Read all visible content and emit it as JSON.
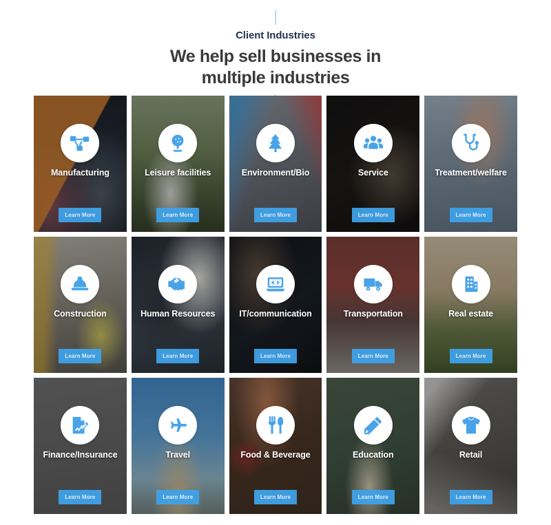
{
  "header": {
    "eyebrow": "Client Industries",
    "headline": "We help sell businesses in multiple industries",
    "headline_line1": "We help sell businesses in",
    "headline_line2": "multiple industries"
  },
  "theme": {
    "accent": "#3fa2e8",
    "icon_blue": "#49a3e8",
    "eyebrow_color": "#23344f",
    "headline_color": "#3a3a3c",
    "badge_bg": "#ffffff",
    "tick_color": "#b9d7f2",
    "page_bg": "#ffffff"
  },
  "cta_label": "Learn More",
  "cards": [
    {
      "label": "Manufacturing",
      "icon": "network-nodes-icon",
      "photo_class": "ph-manufacturing",
      "cta": "Learn More"
    },
    {
      "label": "Leisure facilities",
      "icon": "golf-ball-tee-icon",
      "photo_class": "ph-leisure",
      "cta": "Learn More"
    },
    {
      "label": "Environment/Bio",
      "icon": "pine-tree-icon",
      "photo_class": "ph-environment",
      "cta": "Learn More"
    },
    {
      "label": "Service",
      "icon": "people-group-icon",
      "photo_class": "ph-service",
      "cta": "Learn More"
    },
    {
      "label": "Treatment/welfare",
      "icon": "stethoscope-icon",
      "photo_class": "ph-treatment",
      "cta": "Learn More"
    },
    {
      "label": "Construction",
      "icon": "hard-hat-icon",
      "photo_class": "ph-construction",
      "cta": "Learn More"
    },
    {
      "label": "Human Resources",
      "icon": "handshake-icon",
      "photo_class": "ph-hr",
      "cta": "Learn More"
    },
    {
      "label": "IT/communication",
      "icon": "laptop-code-icon",
      "photo_class": "ph-it",
      "cta": "Learn More"
    },
    {
      "label": "Transportation",
      "icon": "truck-icon",
      "photo_class": "ph-transport",
      "cta": "Learn More"
    },
    {
      "label": "Real estate",
      "icon": "building-icon",
      "photo_class": "ph-realestate",
      "cta": "Learn More"
    },
    {
      "label": "Finance/Insurance",
      "icon": "document-pen-icon",
      "photo_class": "ph-finance",
      "cta": "Learn More"
    },
    {
      "label": "Travel",
      "icon": "airplane-icon",
      "photo_class": "ph-travel",
      "cta": "Learn More"
    },
    {
      "label": "Food & Beverage",
      "icon": "fork-knife-icon",
      "photo_class": "ph-food",
      "cta": "Learn More"
    },
    {
      "label": "Education",
      "icon": "pencil-icon",
      "photo_class": "ph-education",
      "cta": "Learn More"
    },
    {
      "label": "Retail",
      "icon": "tshirt-icon",
      "photo_class": "ph-retail",
      "cta": "Learn More"
    }
  ]
}
